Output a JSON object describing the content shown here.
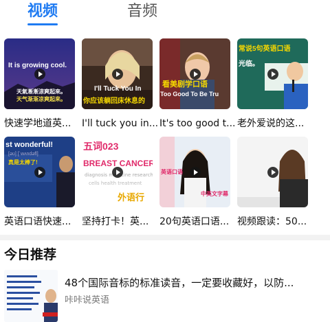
{
  "tabs": [
    {
      "label": "视频",
      "active": true
    },
    {
      "label": "音频",
      "active": false
    }
  ],
  "colors": {
    "accent": "#1f7bf2",
    "divider": "#f2f2f2"
  },
  "videos": [
    {
      "title": "快速学地道英...",
      "overlay": [
        "It is growing cool.",
        "天氣漸漸涼爽起來。",
        "天气渐渐凉爽起来。"
      ]
    },
    {
      "title": "I'll tuck you in...",
      "overlay": [
        "I'll Tuck You In",
        "你应该躺回床休息的"
      ]
    },
    {
      "title": "It's too good t...",
      "overlay": [
        "看美剧学口语",
        "Too Good To Be Tru"
      ]
    },
    {
      "title": "老外爱说的这...",
      "overlay": [
        "常说5句英语口语",
        "光临。"
      ]
    },
    {
      "title": "英语口语快速...",
      "overlay": [
        "st wonderful!",
        "[əʊ] [ˈwʌndəfl]",
        "真是太棒了!"
      ]
    },
    {
      "title": "坚持打卡！英...",
      "overlay": [
        "五词023",
        "BREAST CANCER",
        "外语行"
      ]
    },
    {
      "title": "20句英语口语...",
      "overlay": [
        "英语口语",
        "中英文字幕"
      ]
    },
    {
      "title": "视频跟读：50...",
      "overlay": []
    }
  ],
  "section": {
    "title": "今日推荐"
  },
  "recommended": {
    "title": "48个国际音标的标准读音，一定要收藏好，以防...",
    "author": "咔咔说英语"
  }
}
